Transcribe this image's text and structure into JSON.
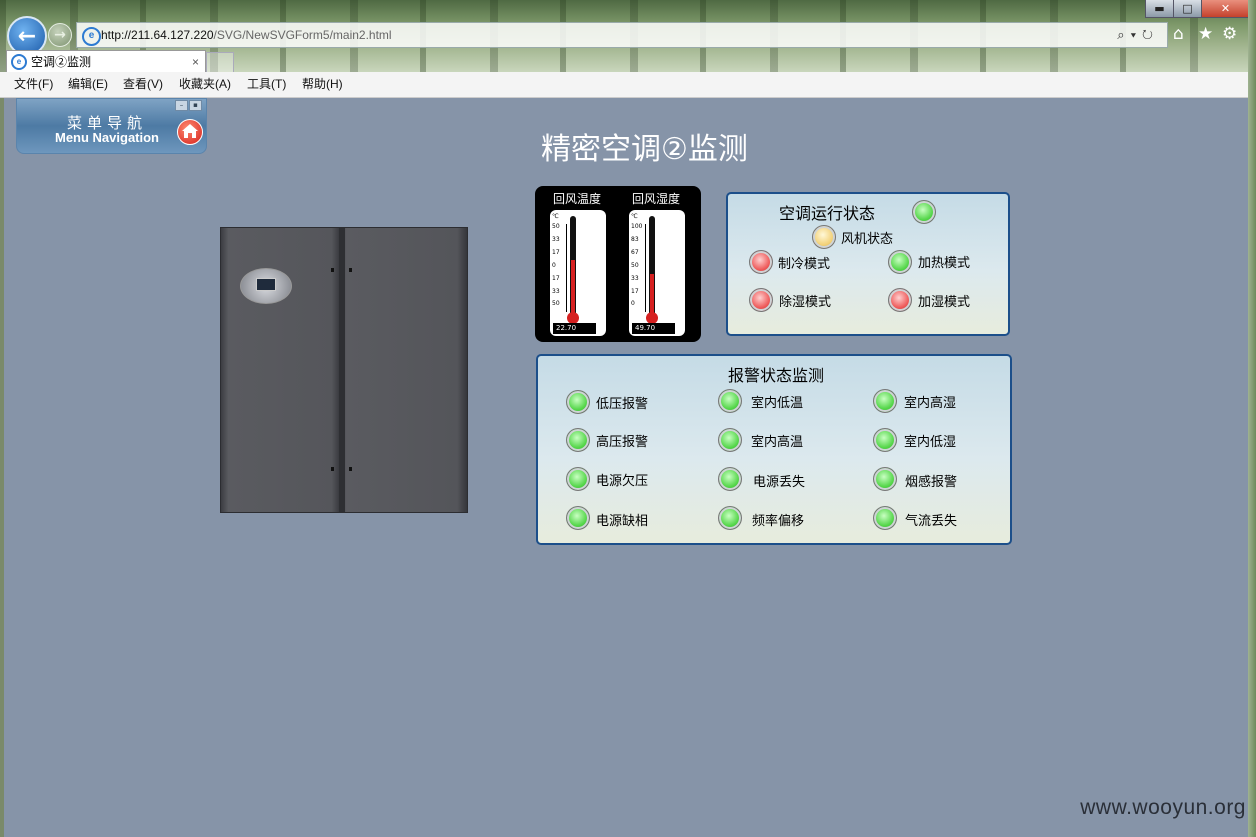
{
  "browser": {
    "url_host": "http://211.64.127.220",
    "url_path": "/SVG/NewSVGForm5/main2.html",
    "tab_title": "空调②监测",
    "tab_close": "×",
    "back_glyph": "←",
    "forward_glyph": "→",
    "addr_tools": "⌕▾↻",
    "window_min": "▬",
    "window_max": "□",
    "window_close": "✕"
  },
  "menubar": {
    "items": [
      "文件(F)",
      "编辑(E)",
      "查看(V)",
      "收藏夹(A)",
      "工具(T)",
      "帮助(H)"
    ]
  },
  "nav": {
    "title_cn": "菜单导航",
    "title_en": "Menu Navigation"
  },
  "page": {
    "title": "精密空调②监测"
  },
  "thermometers": [
    {
      "label": "回风温度",
      "unit": "℃",
      "ticks": [
        "50",
        "33",
        "17",
        "0",
        "17",
        "33",
        "50"
      ],
      "value": "22.70",
      "fill_fraction": 0.6
    },
    {
      "label": "回风湿度",
      "unit": "℃",
      "ticks": [
        "100",
        "83",
        "67",
        "50",
        "33",
        "17",
        "0"
      ],
      "value": "49.70",
      "fill_fraction": 0.45
    }
  ],
  "run_status": {
    "title": "空调运行状态",
    "title_light": "green",
    "items": [
      {
        "label": "风机状态",
        "status": "yellow"
      },
      {
        "label": "制冷模式",
        "status": "red"
      },
      {
        "label": "加热模式",
        "status": "green"
      },
      {
        "label": "除湿模式",
        "status": "red"
      },
      {
        "label": "加湿模式",
        "status": "red"
      }
    ]
  },
  "alarm_status": {
    "title": "报警状态监测",
    "items": [
      {
        "label": "低压报警",
        "status": "green"
      },
      {
        "label": "室内低温",
        "status": "green"
      },
      {
        "label": "室内高湿",
        "status": "green"
      },
      {
        "label": "高压报警",
        "status": "green"
      },
      {
        "label": "室内高温",
        "status": "green"
      },
      {
        "label": "室内低湿",
        "status": "green"
      },
      {
        "label": "电源欠压",
        "status": "green"
      },
      {
        "label": "电源丢失",
        "status": "green"
      },
      {
        "label": "烟感报警",
        "status": "green"
      },
      {
        "label": "电源缺相",
        "status": "green"
      },
      {
        "label": "频率偏移",
        "status": "green"
      },
      {
        "label": "气流丢失",
        "status": "green"
      }
    ]
  },
  "watermark": "www.wooyun.org"
}
